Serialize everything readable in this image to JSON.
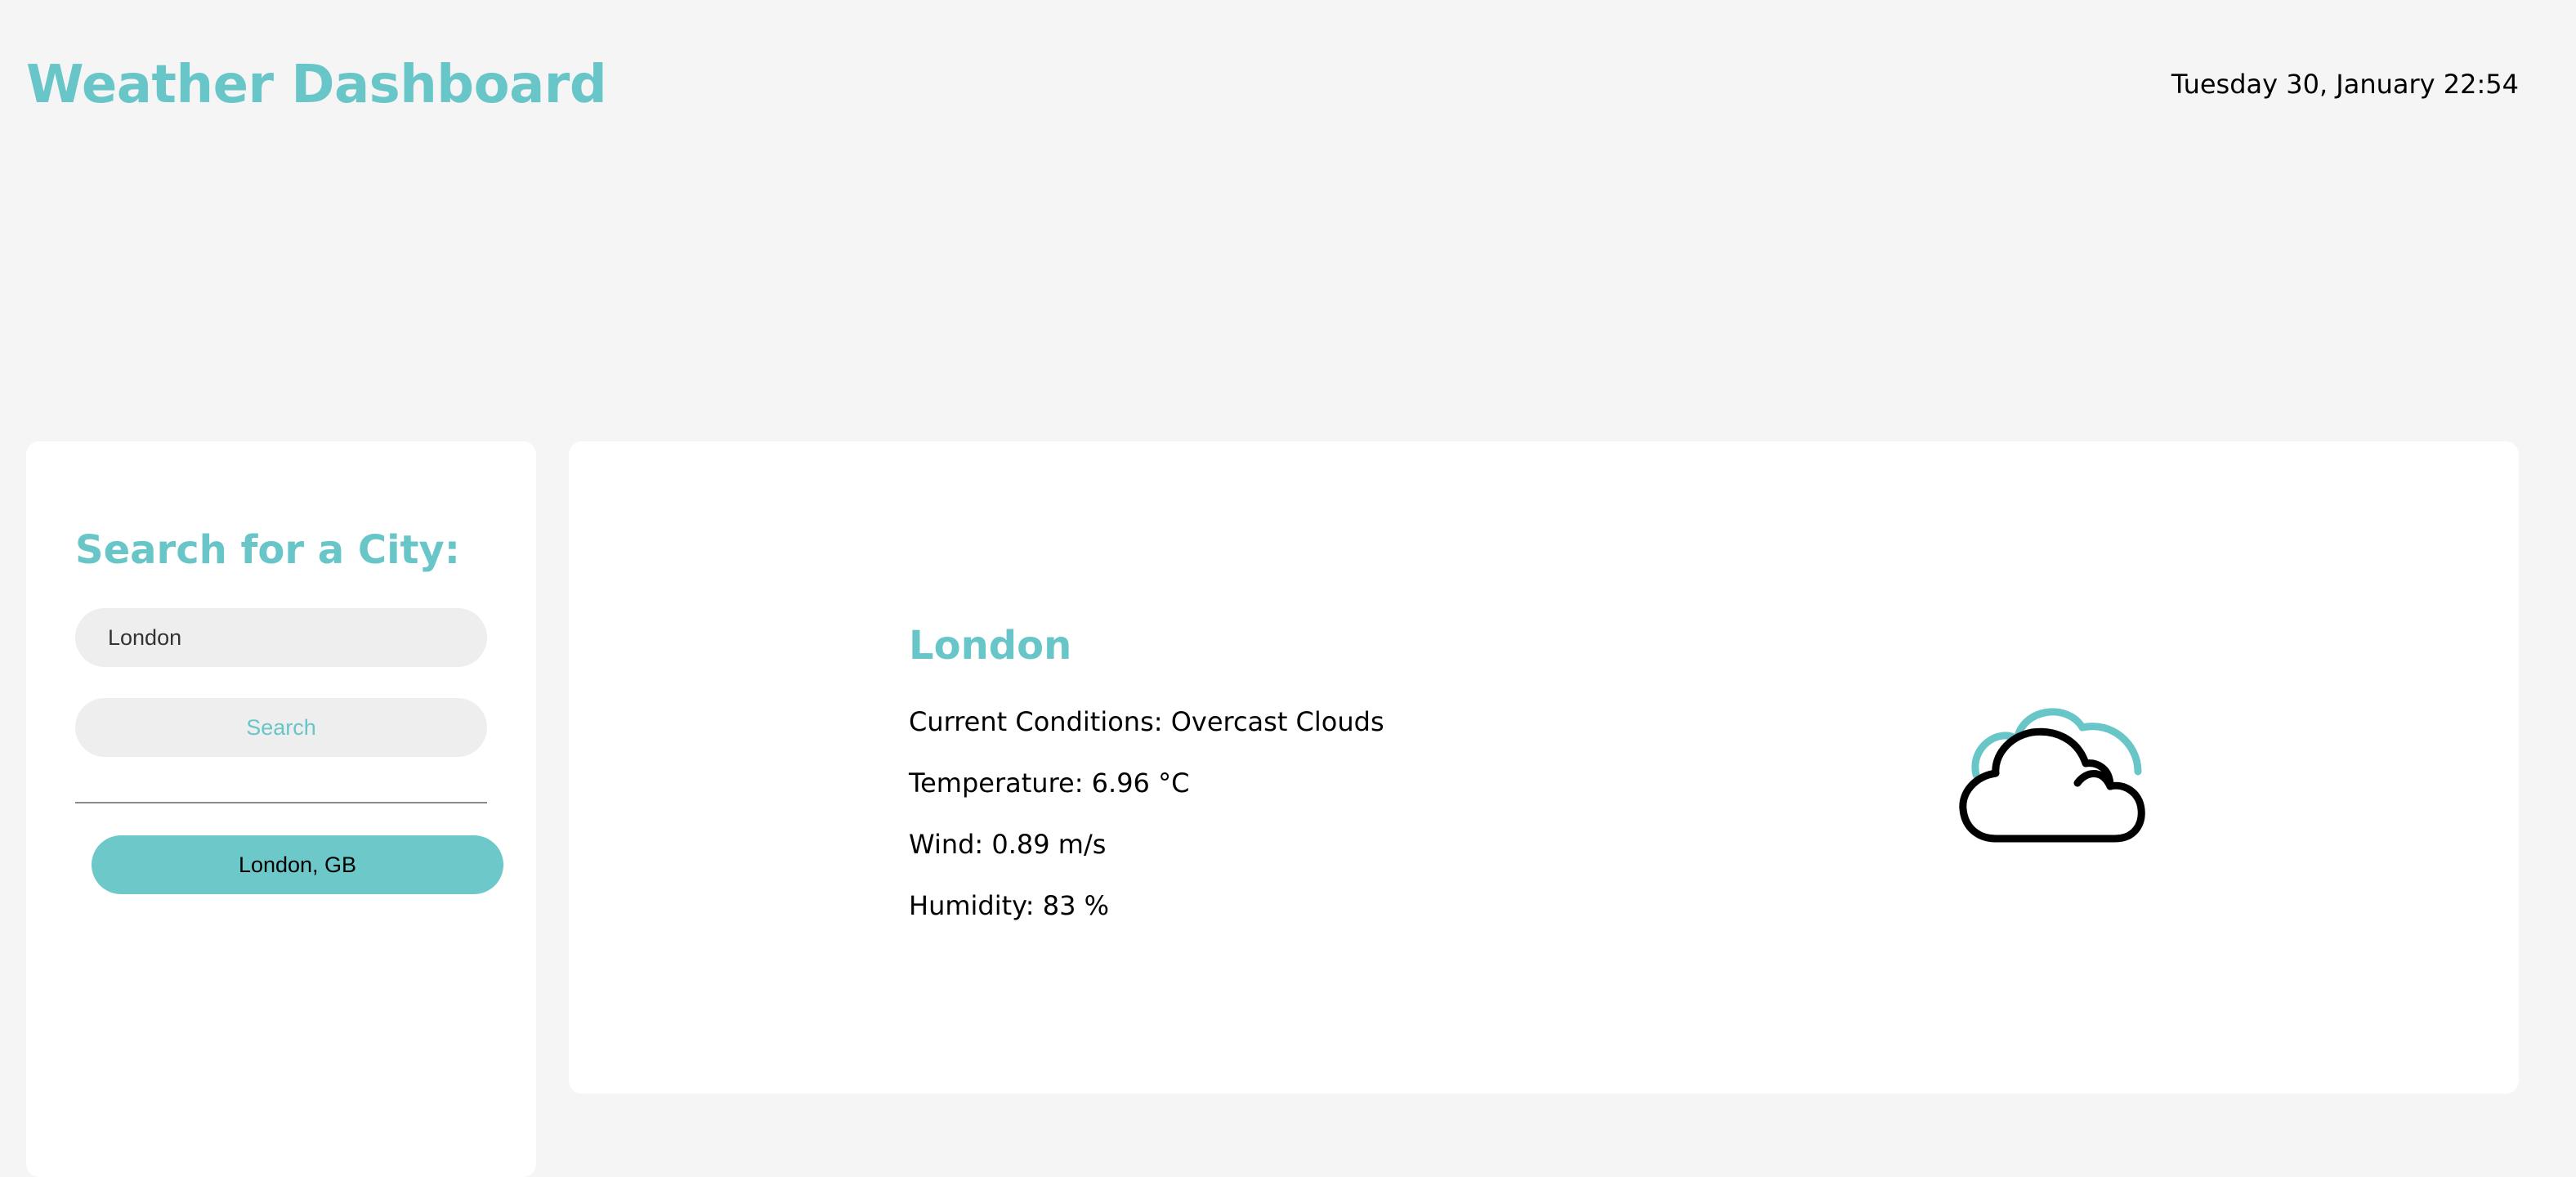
{
  "header": {
    "title": "Weather Dashboard",
    "datetime": "Tuesday 30, January 22:54"
  },
  "sidebar": {
    "heading": "Search for a City:",
    "search_input_value": "London",
    "search_button_label": "Search",
    "history": [
      {
        "label": "London, GB"
      }
    ]
  },
  "current": {
    "city": "London",
    "conditions": "Current Conditions: Overcast Clouds",
    "temperature": "Temperature: 6.96 °C",
    "wind": "Wind: 0.89 m/s",
    "humidity": "Humidity: 83 %",
    "icon": "overcast-clouds-icon"
  },
  "colors": {
    "accent": "#68c6c8",
    "background": "#f5f5f5",
    "card": "#ffffff",
    "input_bg": "#eeeeee"
  }
}
